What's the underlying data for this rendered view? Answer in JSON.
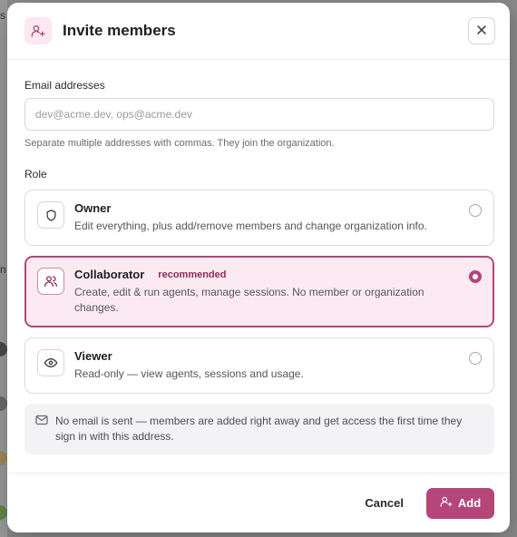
{
  "modal": {
    "title": "Invite members",
    "close_icon": "close-icon",
    "header_icon": "user-plus-icon"
  },
  "email": {
    "label": "Email addresses",
    "placeholder": "dev@acme.dev, ops@acme.dev",
    "value": "",
    "hint": "Separate multiple addresses with commas. They join the organization."
  },
  "role": {
    "label": "Role",
    "selected": "Collaborator",
    "options": [
      {
        "title": "Owner",
        "badge": "",
        "description": "Edit everything, plus add/remove members and change organization info.",
        "icon": "shield-icon"
      },
      {
        "title": "Collaborator",
        "badge": "recommended",
        "description": "Create, edit & run agents, manage sessions. No member or organization changes.",
        "icon": "users-icon"
      },
      {
        "title": "Viewer",
        "badge": "",
        "description": "Read-only — view agents, sessions and usage.",
        "icon": "eye-icon"
      }
    ]
  },
  "notice": {
    "icon": "mail-icon",
    "text": "No email is sent — members are added right away and get access the first time they sign in with this address."
  },
  "footer": {
    "cancel_label": "Cancel",
    "add_label": "Add"
  },
  "colors": {
    "accent": "#b54679",
    "accent_bg": "#fbeaf1",
    "badge_text": "#8e2c5a"
  }
}
